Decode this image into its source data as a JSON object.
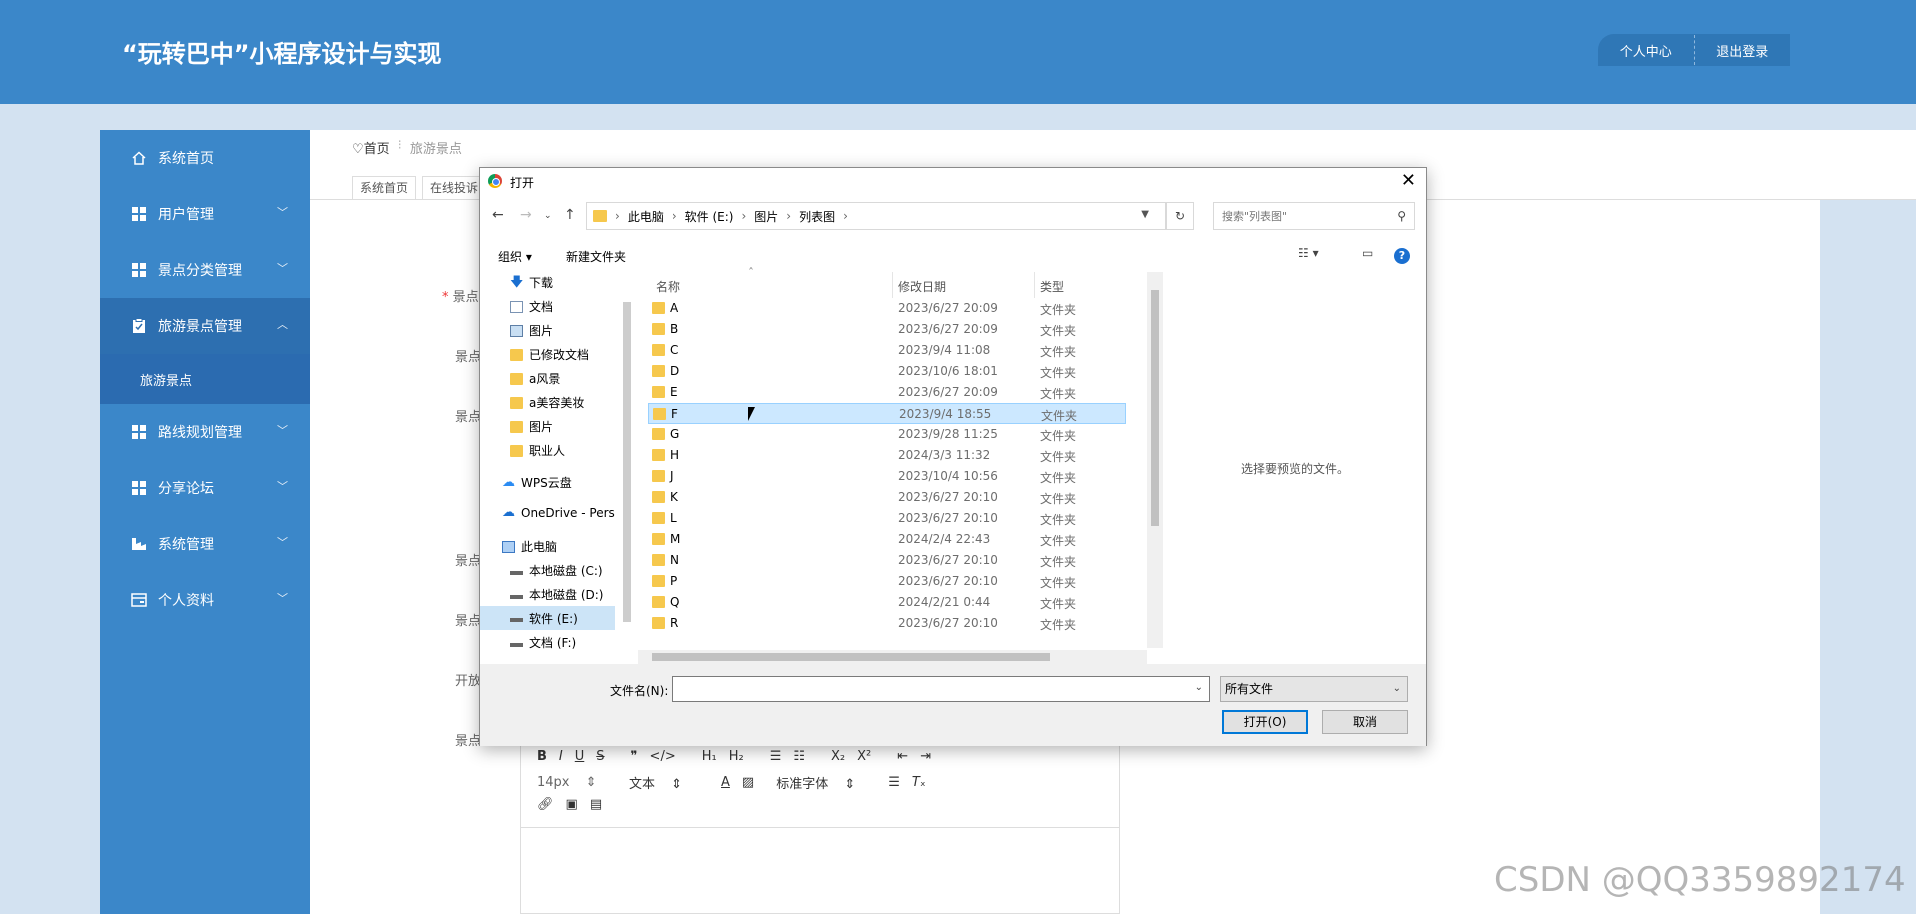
{
  "header": {
    "title": "“玩转巴中”小程序设计与实现",
    "personal_center": "个人中心",
    "logout": "退出登录"
  },
  "sidebar": {
    "items": [
      {
        "label": "系统首页",
        "icon": "home-icon"
      },
      {
        "label": "用户管理",
        "icon": "grid-icon"
      },
      {
        "label": "景点分类管理",
        "icon": "grid-icon"
      },
      {
        "label": "旅游景点管理",
        "icon": "clipboard-icon",
        "expanded": true
      },
      {
        "label": "路线规划管理",
        "icon": "grid-icon"
      },
      {
        "label": "分享论坛",
        "icon": "grid-icon"
      },
      {
        "label": "系统管理",
        "icon": "gear-icon"
      },
      {
        "label": "个人资料",
        "icon": "card-icon"
      }
    ],
    "sub_item": "旅游景点"
  },
  "breadcrumb": {
    "home": "首页",
    "current": "旅游景点"
  },
  "tabs": [
    "系统首页",
    "在线投诉"
  ],
  "form": {
    "labels": [
      "* 景点",
      "景点",
      "景点",
      "景点",
      "景点",
      "开放",
      "景点"
    ]
  },
  "editor": {
    "font_size": "14px",
    "block": "文本",
    "font": "标准字体"
  },
  "dialog": {
    "title": "打开",
    "path": [
      "此电脑",
      "软件 (E:)",
      "图片",
      "列表图"
    ],
    "search_placeholder": "搜索\"列表图\"",
    "organize": "组织 ▾",
    "new_folder": "新建文件夹",
    "left_pane": [
      {
        "label": "下载",
        "pinned": true
      },
      {
        "label": "文档",
        "pinned": true
      },
      {
        "label": "图片",
        "pinned": true
      },
      {
        "label": "已修改文档",
        "pinned": true
      },
      {
        "label": "a风景"
      },
      {
        "label": "a美容美妆"
      },
      {
        "label": "图片"
      },
      {
        "label": "职业人"
      },
      {
        "label": "WPS云盘"
      },
      {
        "label": "OneDrive - Pers"
      },
      {
        "label": "此电脑"
      },
      {
        "label": "本地磁盘 (C:)"
      },
      {
        "label": "本地磁盘 (D:)"
      },
      {
        "label": "软件 (E:)",
        "selected": true
      },
      {
        "label": "文档 (F:)"
      }
    ],
    "columns": {
      "name": "名称",
      "date": "修改日期",
      "type": "类型"
    },
    "rows": [
      {
        "name": "A",
        "date": "2023/6/27 20:09",
        "type": "文件夹"
      },
      {
        "name": "B",
        "date": "2023/6/27 20:09",
        "type": "文件夹"
      },
      {
        "name": "C",
        "date": "2023/9/4 11:08",
        "type": "文件夹"
      },
      {
        "name": "D",
        "date": "2023/10/6 18:01",
        "type": "文件夹"
      },
      {
        "name": "E",
        "date": "2023/6/27 20:09",
        "type": "文件夹"
      },
      {
        "name": "F",
        "date": "2023/9/4 18:55",
        "type": "文件夹",
        "selected": true
      },
      {
        "name": "G",
        "date": "2023/9/28 11:25",
        "type": "文件夹"
      },
      {
        "name": "H",
        "date": "2024/3/3 11:32",
        "type": "文件夹"
      },
      {
        "name": "J",
        "date": "2023/10/4 10:56",
        "type": "文件夹"
      },
      {
        "name": "K",
        "date": "2023/6/27 20:10",
        "type": "文件夹"
      },
      {
        "name": "L",
        "date": "2023/6/27 20:10",
        "type": "文件夹"
      },
      {
        "name": "M",
        "date": "2024/2/4 22:43",
        "type": "文件夹"
      },
      {
        "name": "N",
        "date": "2023/6/27 20:10",
        "type": "文件夹"
      },
      {
        "name": "P",
        "date": "2023/6/27 20:10",
        "type": "文件夹"
      },
      {
        "name": "Q",
        "date": "2024/2/21 0:44",
        "type": "文件夹"
      },
      {
        "name": "R",
        "date": "2023/6/27 20:10",
        "type": "文件夹"
      }
    ],
    "preview_text": "选择要预览的文件。",
    "filename_label": "文件名(N):",
    "filename_value": "",
    "filetype": "所有文件",
    "open": "打开(O)",
    "cancel": "取消"
  },
  "watermark": "CSDN @QQ3359892174"
}
